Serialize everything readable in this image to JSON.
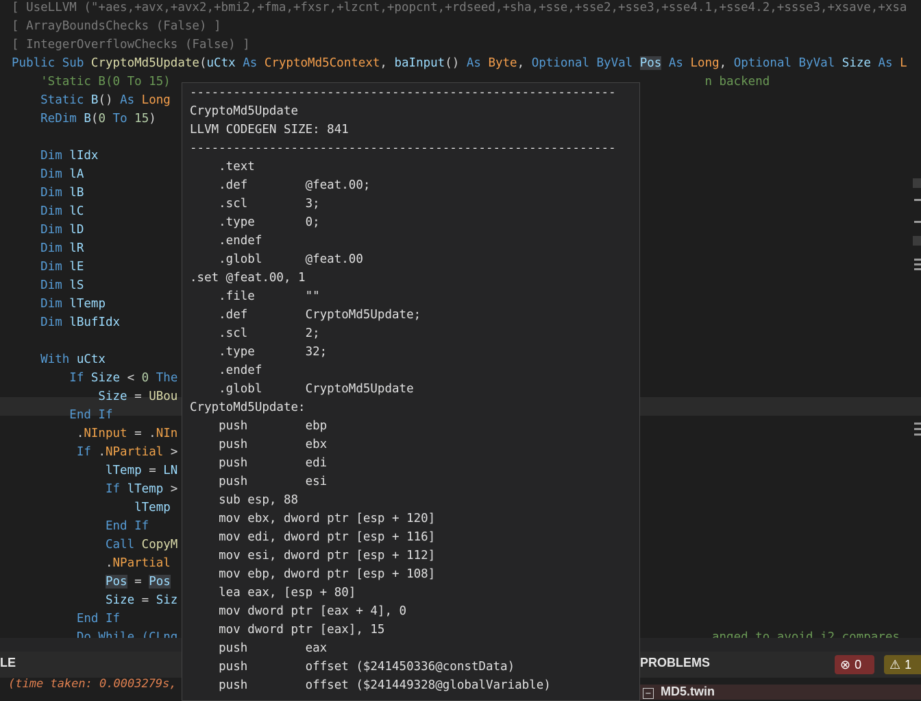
{
  "editor": {
    "lines": [
      {
        "segs": [
          {
            "t": "[ UseLLVM (\"+aes,+avx,+avx2,+bmi2,+fma,+fxsr,+lzcnt,+popcnt,+rdseed,+sha,+sse,+sse2,+sse3,+sse4.1,+sse4.2,+ssse3,+xsave,+xsa",
            "c": "gray"
          }
        ]
      },
      {
        "segs": [
          {
            "t": "[ ArrayBoundsChecks (False) ]",
            "c": "gray"
          }
        ]
      },
      {
        "segs": [
          {
            "t": "[ IntegerOverflowChecks (False) ]",
            "c": "gray"
          }
        ]
      },
      {
        "segs": [
          {
            "t": "Public Sub ",
            "c": "kw"
          },
          {
            "t": "CryptoMd5Update",
            "c": "fn"
          },
          {
            "t": "(",
            "c": "pl"
          },
          {
            "t": "uCtx",
            "c": "id"
          },
          {
            "t": " As ",
            "c": "kw"
          },
          {
            "t": "CryptoMd5Context",
            "c": "ty"
          },
          {
            "t": ", ",
            "c": "pl"
          },
          {
            "t": "baInput",
            "c": "id"
          },
          {
            "t": "() ",
            "c": "pl"
          },
          {
            "t": "As ",
            "c": "kw"
          },
          {
            "t": "Byte",
            "c": "ty"
          },
          {
            "t": ", ",
            "c": "pl"
          },
          {
            "t": "Optional ByVal ",
            "c": "kw"
          },
          {
            "t": "Pos",
            "c": "id hl"
          },
          {
            "t": " As ",
            "c": "kw"
          },
          {
            "t": "Long",
            "c": "ty"
          },
          {
            "t": ", ",
            "c": "pl"
          },
          {
            "t": "Optional ByVal ",
            "c": "kw"
          },
          {
            "t": "Size",
            "c": "id"
          },
          {
            "t": " As ",
            "c": "kw"
          },
          {
            "t": "L",
            "c": "ty"
          }
        ]
      },
      {
        "segs": [
          {
            "t": "    'Static B(0 To 15)",
            "c": "cm"
          },
          {
            "t": "                                                                          ",
            "c": "pl"
          },
          {
            "t": "n backend",
            "c": "cm"
          }
        ]
      },
      {
        "segs": [
          {
            "t": "    Static ",
            "c": "kw"
          },
          {
            "t": "B",
            "c": "id"
          },
          {
            "t": "() ",
            "c": "pl"
          },
          {
            "t": "As ",
            "c": "kw"
          },
          {
            "t": "Long",
            "c": "ty"
          }
        ]
      },
      {
        "segs": [
          {
            "t": "    ReDim ",
            "c": "kw"
          },
          {
            "t": "B",
            "c": "id"
          },
          {
            "t": "(",
            "c": "pl"
          },
          {
            "t": "0",
            "c": "nm"
          },
          {
            "t": " To ",
            "c": "kw"
          },
          {
            "t": "15",
            "c": "nm"
          },
          {
            "t": ")",
            "c": "pl"
          }
        ]
      },
      {
        "segs": [
          {
            "t": "",
            "c": "pl"
          }
        ]
      },
      {
        "segs": [
          {
            "t": "    Dim ",
            "c": "kw"
          },
          {
            "t": "lIdx",
            "c": "id"
          }
        ]
      },
      {
        "segs": [
          {
            "t": "    Dim ",
            "c": "kw"
          },
          {
            "t": "lA",
            "c": "id"
          }
        ]
      },
      {
        "segs": [
          {
            "t": "    Dim ",
            "c": "kw"
          },
          {
            "t": "lB",
            "c": "id"
          }
        ]
      },
      {
        "segs": [
          {
            "t": "    Dim ",
            "c": "kw"
          },
          {
            "t": "lC",
            "c": "id"
          }
        ]
      },
      {
        "segs": [
          {
            "t": "    Dim ",
            "c": "kw"
          },
          {
            "t": "lD",
            "c": "id"
          }
        ]
      },
      {
        "segs": [
          {
            "t": "    Dim ",
            "c": "kw"
          },
          {
            "t": "lR",
            "c": "id"
          }
        ]
      },
      {
        "segs": [
          {
            "t": "    Dim ",
            "c": "kw"
          },
          {
            "t": "lE",
            "c": "id"
          }
        ]
      },
      {
        "segs": [
          {
            "t": "    Dim ",
            "c": "kw"
          },
          {
            "t": "lS",
            "c": "id"
          }
        ]
      },
      {
        "segs": [
          {
            "t": "    Dim ",
            "c": "kw"
          },
          {
            "t": "lTemp",
            "c": "id"
          }
        ]
      },
      {
        "segs": [
          {
            "t": "    Dim ",
            "c": "kw"
          },
          {
            "t": "lBufIdx",
            "c": "id"
          }
        ]
      },
      {
        "segs": [
          {
            "t": "",
            "c": "pl"
          }
        ]
      },
      {
        "segs": [
          {
            "t": "    With ",
            "c": "kw"
          },
          {
            "t": "uCtx",
            "c": "id"
          }
        ]
      },
      {
        "segs": [
          {
            "t": "        If ",
            "c": "kw"
          },
          {
            "t": "Size",
            "c": "id"
          },
          {
            "t": " < ",
            "c": "pl"
          },
          {
            "t": "0",
            "c": "nm"
          },
          {
            "t": " The",
            "c": "kw"
          }
        ]
      },
      {
        "segs": [
          {
            "t": "            Size",
            "c": "id"
          },
          {
            "t": " = ",
            "c": "pl"
          },
          {
            "t": "UBou",
            "c": "fn"
          }
        ]
      },
      {
        "segs": [
          {
            "t": "        End If",
            "c": "kw"
          }
        ]
      },
      {
        "segs": [
          {
            "t": "         .",
            "c": "pl"
          },
          {
            "t": "NInput",
            "c": "prop"
          },
          {
            "t": " = .",
            "c": "pl"
          },
          {
            "t": "NIn",
            "c": "prop"
          }
        ]
      },
      {
        "segs": [
          {
            "t": "         If ",
            "c": "kw"
          },
          {
            "t": ".",
            "c": "pl"
          },
          {
            "t": "NPartial",
            "c": "prop"
          },
          {
            "t": " >",
            "c": "pl"
          }
        ]
      },
      {
        "segs": [
          {
            "t": "             lTemp",
            "c": "id"
          },
          {
            "t": " = ",
            "c": "pl"
          },
          {
            "t": "LN",
            "c": "id"
          }
        ]
      },
      {
        "segs": [
          {
            "t": "             If ",
            "c": "kw"
          },
          {
            "t": "lTemp",
            "c": "id"
          },
          {
            "t": " >",
            "c": "pl"
          }
        ]
      },
      {
        "segs": [
          {
            "t": "                 lTemp",
            "c": "id"
          }
        ]
      },
      {
        "segs": [
          {
            "t": "             End If",
            "c": "kw"
          }
        ]
      },
      {
        "segs": [
          {
            "t": "             Call ",
            "c": "kw"
          },
          {
            "t": "CopyM",
            "c": "fn"
          }
        ]
      },
      {
        "segs": [
          {
            "t": "             .",
            "c": "pl"
          },
          {
            "t": "NPartial",
            "c": "prop"
          }
        ]
      },
      {
        "segs": [
          {
            "t": "             ",
            "c": "pl"
          },
          {
            "t": "Pos",
            "c": "id hl"
          },
          {
            "t": " = ",
            "c": "pl"
          },
          {
            "t": "Pos",
            "c": "id hl"
          }
        ]
      },
      {
        "segs": [
          {
            "t": "             Size",
            "c": "id"
          },
          {
            "t": " = ",
            "c": "pl"
          },
          {
            "t": "Siz",
            "c": "id"
          }
        ]
      },
      {
        "segs": [
          {
            "t": "         End If",
            "c": "kw"
          }
        ]
      },
      {
        "segs": [
          {
            "t": "         Do While (CLng",
            "c": "kw"
          },
          {
            "t": "                                                                          ",
            "c": "pl"
          },
          {
            "t": "anged to avoid i2 compares",
            "c": "cm"
          }
        ]
      }
    ]
  },
  "tooltip": {
    "lines": [
      "-----------------------------------------------------------",
      "CryptoMd5Update",
      "LLVM CODEGEN SIZE: 841",
      "-----------------------------------------------------------",
      "    .text",
      "    .def        @feat.00;",
      "    .scl        3;",
      "    .type       0;",
      "    .endef",
      "    .globl      @feat.00",
      ".set @feat.00, 1",
      "    .file       \"\"",
      "    .def        CryptoMd5Update;",
      "    .scl        2;",
      "    .type       32;",
      "    .endef",
      "    .globl      CryptoMd5Update",
      "CryptoMd5Update:",
      "    push        ebp",
      "    push        ebx",
      "    push        edi",
      "    push        esi",
      "    sub esp, 88",
      "    mov ebx, dword ptr [esp + 120]",
      "    mov edi, dword ptr [esp + 116]",
      "    mov esi, dword ptr [esp + 112]",
      "    mov ebp, dword ptr [esp + 108]",
      "    lea eax, [esp + 80]",
      "    mov dword ptr [eax + 4], 0",
      "    mov dword ptr [eax], 15",
      "    push        eax",
      "    push        offset ($241450336@constData)",
      "    push        offset ($241449328@globalVariable)"
    ]
  },
  "bottom": {
    "left_panel_title": "LE",
    "time_taken": "(time taken: 0.0003279s,",
    "problems_title": "PROBLEMS",
    "error_count": "0",
    "warning_count": "1",
    "file_name": "MD5.twin",
    "error_icon": "error-circle-icon",
    "warning_icon": "warning-triangle-icon"
  },
  "colors": {
    "keyword": "#569cd6",
    "type": "#f59f4c",
    "function": "#dcdcaa",
    "identifier": "#9cdcfe",
    "comment": "#6a9955",
    "error_badge": "#7a2e2e",
    "warning_badge": "#6b5b1e"
  }
}
